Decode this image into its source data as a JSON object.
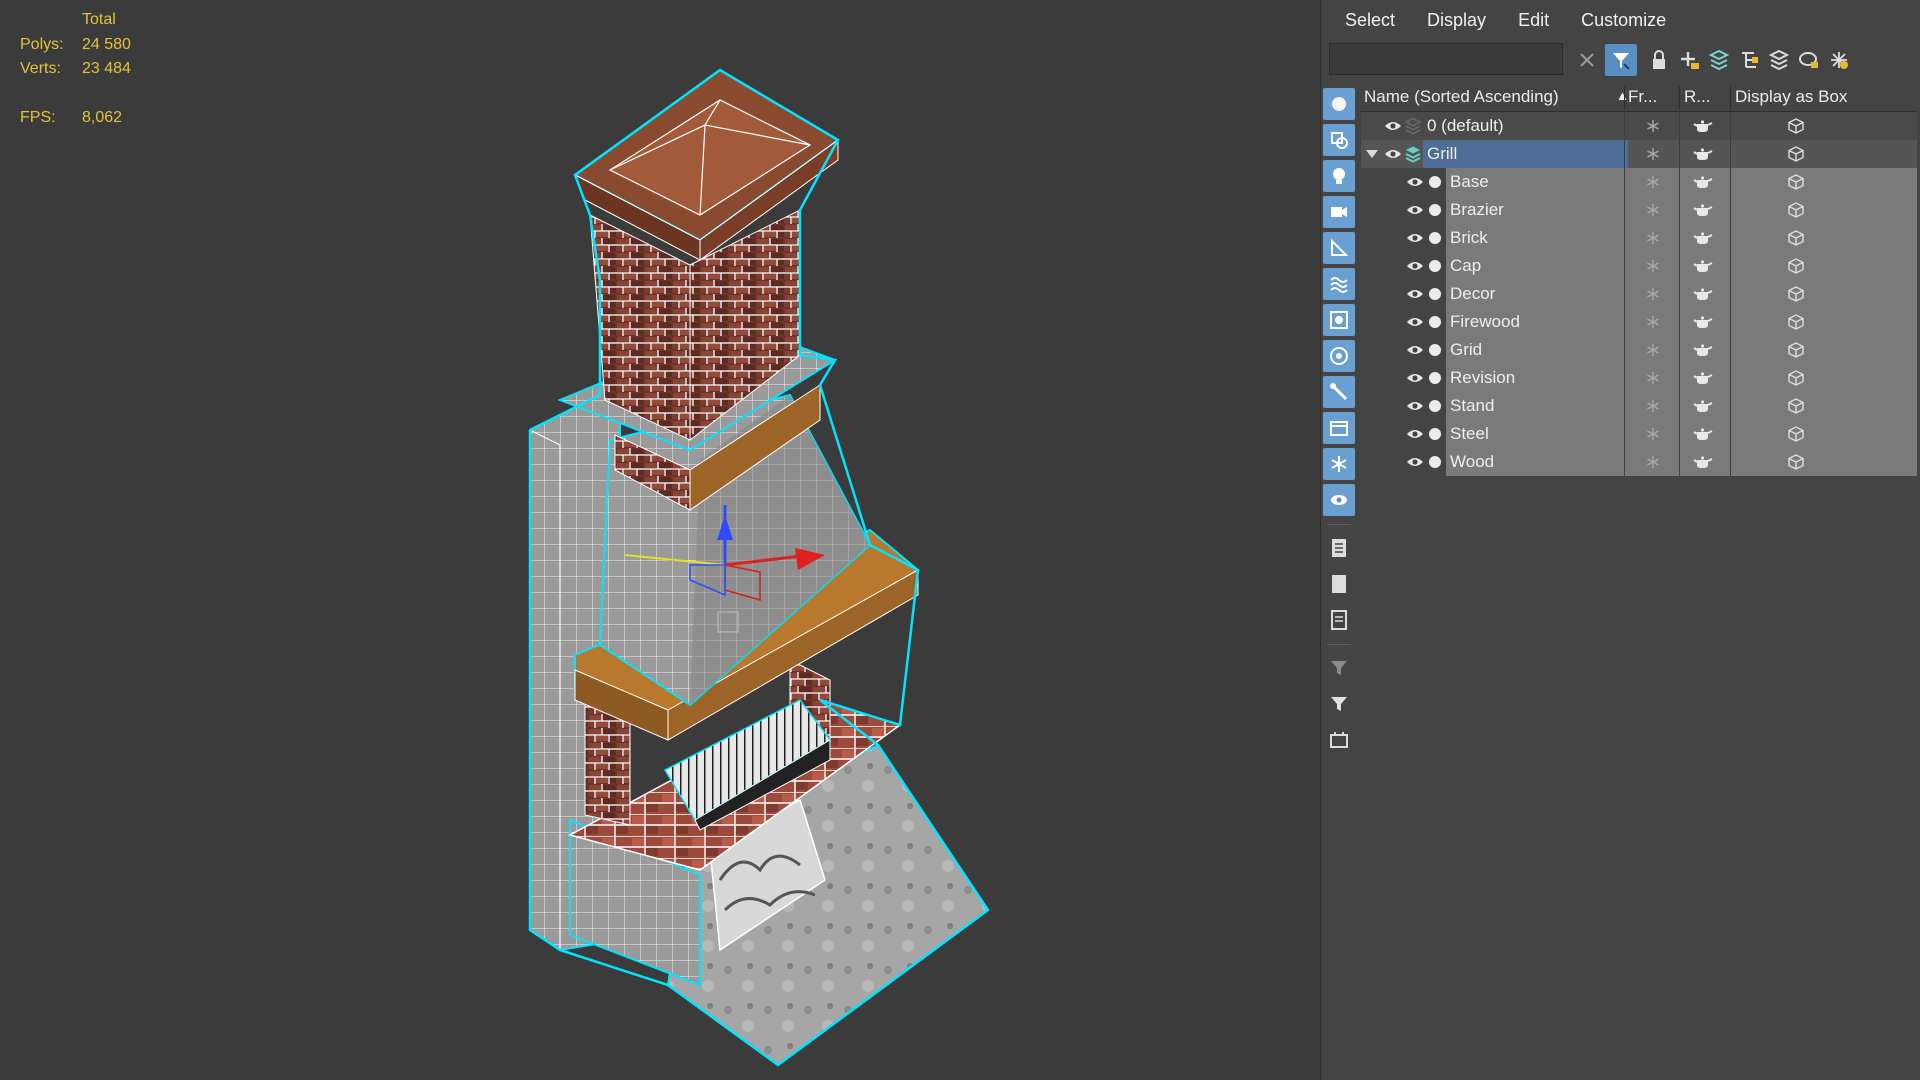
{
  "viewport": {
    "stats": {
      "total_label": "Total",
      "polys_label": "Polys:",
      "polys_value": "24 580",
      "verts_label": "Verts:",
      "verts_value": "23 484",
      "fps_label": "FPS:",
      "fps_value": "8,062"
    }
  },
  "explorer": {
    "menu": [
      "Select",
      "Display",
      "Edit",
      "Customize"
    ],
    "search": {
      "value": "",
      "placeholder": ""
    },
    "toolbar_icons": [
      "clear-search-icon",
      "filter-icon",
      "lock-icon",
      "create-layer-icon",
      "add-to-layer-icon",
      "hierarchy-icon",
      "layers-icon",
      "highlight-icon",
      "layer-settings-icon"
    ],
    "sidebar_icons": [
      "geometry-icon",
      "shapes-icon",
      "lights-icon",
      "cameras-icon",
      "helpers-icon",
      "space-warps-icon",
      "groups-icon",
      "xrefs-icon",
      "bones-icon",
      "containers-icon",
      "frozen-icon",
      "hidden-icon",
      "all-icon",
      "none-icon",
      "invert-icon",
      "filter-selected-icon",
      "filter-icon-2",
      "layer-toggle-icon"
    ],
    "columns": {
      "name": "Name (Sorted Ascending)",
      "frozen": "Fr...",
      "renderable": "R...",
      "display_as_box": "Display as Box"
    },
    "rows": [
      {
        "name": "0 (default)",
        "level": 0,
        "type": "layer"
      },
      {
        "name": "Grill",
        "level": 0,
        "type": "layer",
        "expanded": true,
        "selected": true
      },
      {
        "name": "Base",
        "level": 1,
        "type": "object"
      },
      {
        "name": "Brazier",
        "level": 1,
        "type": "object"
      },
      {
        "name": "Brick",
        "level": 1,
        "type": "object"
      },
      {
        "name": "Cap",
        "level": 1,
        "type": "object"
      },
      {
        "name": "Decor",
        "level": 1,
        "type": "object"
      },
      {
        "name": "Firewood",
        "level": 1,
        "type": "object"
      },
      {
        "name": "Grid",
        "level": 1,
        "type": "object"
      },
      {
        "name": "Revision",
        "level": 1,
        "type": "object"
      },
      {
        "name": "Stand",
        "level": 1,
        "type": "object"
      },
      {
        "name": "Steel",
        "level": 1,
        "type": "object"
      },
      {
        "name": "Wood",
        "level": 1,
        "type": "object"
      }
    ]
  },
  "colors": {
    "background": "#3b3b3b",
    "stats_yellow": "#e6c23a",
    "selection_blue": "#5a8fc4",
    "selected_rows": "#777777",
    "wire_cyan": "#00e5ff",
    "brick_red": "#7a3a2e",
    "roof_brown": "#8a4a30",
    "stone_gray": "#9b9b9b",
    "wood_orange": "#b8782e"
  }
}
